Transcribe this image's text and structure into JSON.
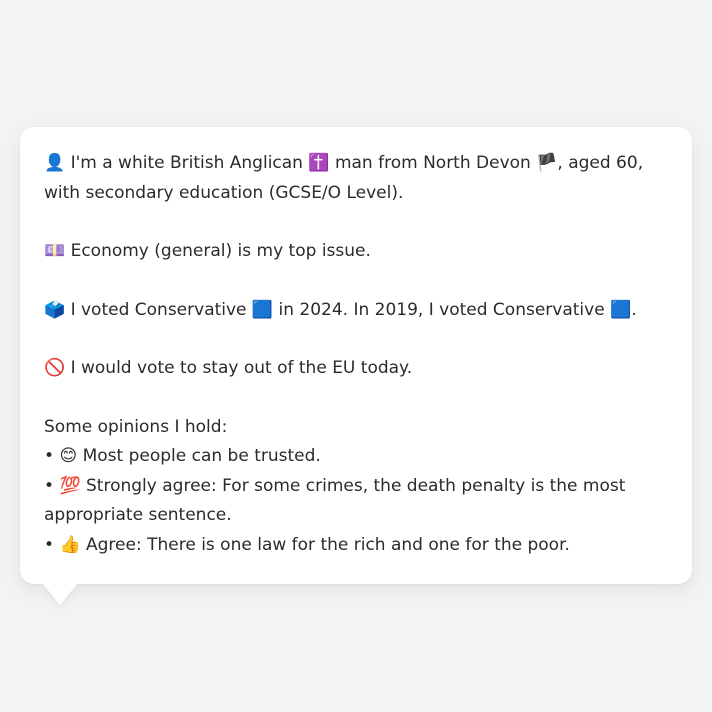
{
  "profile": {
    "identity_icon": "👤",
    "identity_prefix": "I'm a white British Anglican",
    "religion_icon": "✝️",
    "identity_middle": "man from North Devon",
    "region_icon": "🏴",
    "identity_suffix": ", aged 60, with secondary education (GCSE/O Level).",
    "issue_icon": "💷",
    "issue_text": "Economy (general) is my top issue.",
    "vote_icon": "🗳️",
    "vote_text_1": "I voted Conservative",
    "party_icon_1": "🟦",
    "vote_text_2": "in 2024. In 2019, I voted Conservative",
    "party_icon_2": "🟦",
    "vote_text_end": ".",
    "eu_icon": "🚫",
    "eu_text": "I would vote to stay out of the EU today.",
    "opinions_heading": "Some opinions I hold:",
    "opinions": [
      {
        "bullet": "•",
        "icon": "😊",
        "text": "Most people can be trusted."
      },
      {
        "bullet": "•",
        "icon": "💯",
        "text": "Strongly agree: For some crimes, the death penalty is the most appropriate sentence."
      },
      {
        "bullet": "•",
        "icon": "👍",
        "text": "Agree: There is one law for the rich and one for the poor."
      }
    ]
  }
}
